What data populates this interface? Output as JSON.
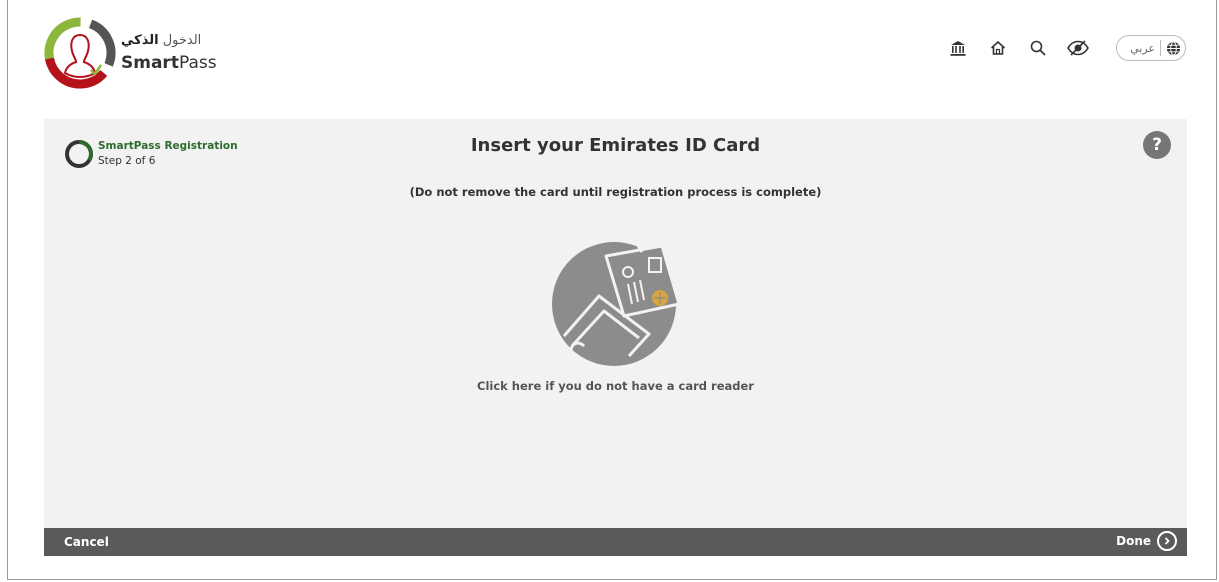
{
  "logo": {
    "arabic_light": "الدخول",
    "arabic_bold": "الذكي",
    "english_bold": "Smart",
    "english_light": "Pass",
    "colors": {
      "green": "#8db63c",
      "red": "#b5121b",
      "gray": "#555555"
    }
  },
  "toolbar": {
    "icons": [
      "government-icon",
      "home-icon",
      "search-icon",
      "accessibility-eye-icon",
      "globe-icon"
    ],
    "language_label": "عربي"
  },
  "registration": {
    "title": "SmartPass Registration",
    "step": "Step 2 of 6"
  },
  "main": {
    "title": "Insert your Emirates ID Card",
    "notice": "(Do not remove the card until registration process is complete)",
    "no_reader_link": "Click here if you do not have a card reader",
    "help_label": "?"
  },
  "footer": {
    "cancel_label": "Cancel",
    "done_label": "Done"
  },
  "colors": {
    "panel_bg": "#f2f2f2",
    "footer_bg": "#5a5a5a",
    "step_green": "#2e6b2e",
    "chip_gold": "#d9a441"
  }
}
